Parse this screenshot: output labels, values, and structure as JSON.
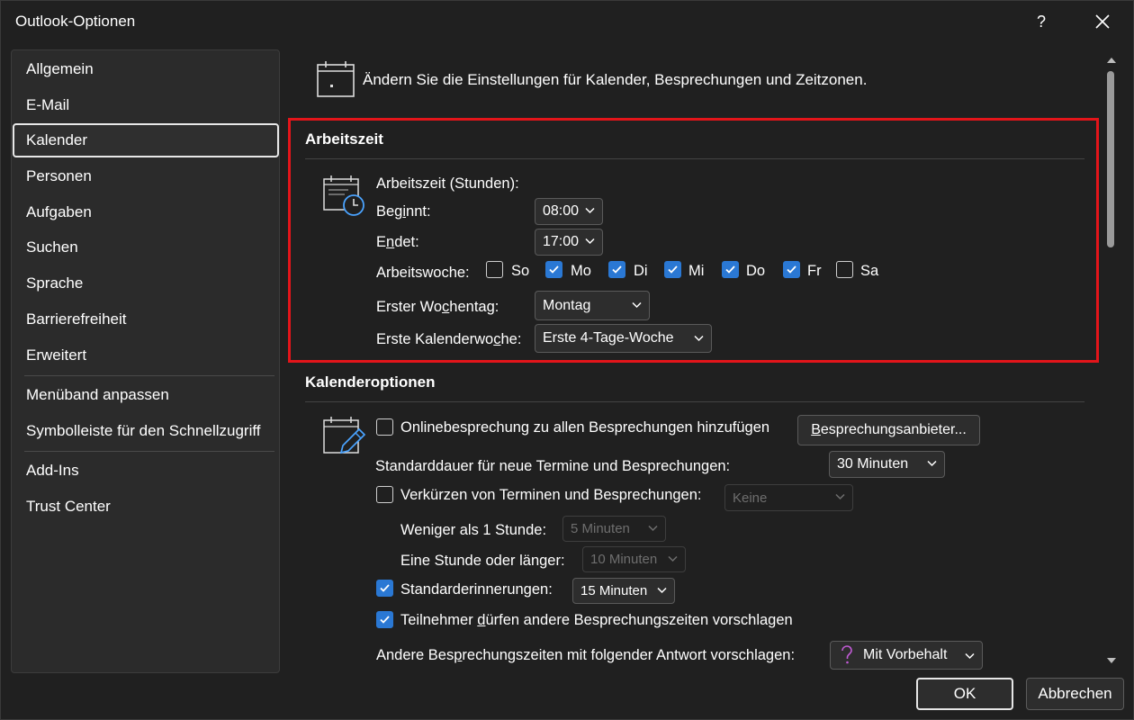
{
  "window": {
    "title": "Outlook-Optionen",
    "help_label": "?"
  },
  "sidebar": {
    "items": [
      {
        "label": "Allgemein"
      },
      {
        "label": "E-Mail"
      },
      {
        "label": "Kalender",
        "selected": true
      },
      {
        "label": "Personen"
      },
      {
        "label": "Aufgaben"
      },
      {
        "label": "Suchen"
      },
      {
        "label": "Sprache"
      },
      {
        "label": "Barrierefreiheit"
      },
      {
        "label": "Erweitert"
      },
      {
        "label": "Menüband anpassen"
      },
      {
        "label": "Symbolleiste für den Schnellzugriff"
      },
      {
        "label": "Add-Ins"
      },
      {
        "label": "Trust Center"
      }
    ]
  },
  "main": {
    "header_text": "Ändern Sie die Einstellungen für Kalender, Besprechungen und Zeitzonen.",
    "work_time": {
      "section_title": "Arbeitszeit",
      "hours_label": "Arbeitszeit (Stunden):",
      "start_label_pre": "Beg",
      "start_label_u": "i",
      "start_label_post": "nnt:",
      "start_value": "08:00",
      "end_label_pre": "E",
      "end_label_u": "n",
      "end_label_post": "det:",
      "end_value": "17:00",
      "week_label": "Arbeitswoche:",
      "days": [
        {
          "label": "So",
          "checked": false
        },
        {
          "label": "Mo",
          "checked": true
        },
        {
          "label": "Di",
          "checked": true
        },
        {
          "label": "Mi",
          "checked": true
        },
        {
          "label": "Do",
          "checked": true
        },
        {
          "label": "Fr",
          "checked": true
        },
        {
          "label": "Sa",
          "checked": false
        }
      ],
      "first_day_label_pre": "Erster Wo",
      "first_day_label_u": "c",
      "first_day_label_post": "hentag:",
      "first_day_value": "Montag",
      "first_week_label_pre": "Erste Kalenderwo",
      "first_week_label_u": "c",
      "first_week_label_post": "he:",
      "first_week_value": "Erste 4-Tage-Woche"
    },
    "calendar_options": {
      "section_title": "Kalenderoptionen",
      "online_meeting_label": "Onlinebesprechung zu allen Besprechungen hinzufügen",
      "online_meeting_checked": false,
      "provider_button_pre": "",
      "provider_button_u": "B",
      "provider_button_post": "esprechungsanbieter...",
      "default_duration_label": "Standarddauer für neue Termine und Besprechungen:",
      "default_duration_value": "30 Minuten",
      "shorten_label": "Verkürzen von Terminen und Besprechungen:",
      "shorten_checked": false,
      "shorten_value": "Keine",
      "less_hour_label": "Weniger als 1 Stunde:",
      "less_hour_value": "5 Minuten",
      "hour_more_label": "Eine Stunde oder länger:",
      "hour_more_value": "10 Minuten",
      "reminders_label": "Standarderinnerungen:",
      "reminders_checked": true,
      "reminders_value": "15 Minuten",
      "propose_label_pre": "Teilnehmer ",
      "propose_label_u": "d",
      "propose_label_post": "ürfen andere Besprechungszeiten vorschlagen",
      "propose_checked": true,
      "response_label_pre": "Andere Bes",
      "response_label_u": "p",
      "response_label_post": "rechungszeiten mit folgender Antwort vorschlagen:",
      "response_value": "Mit Vorbehalt",
      "response_icon": "question-mark-icon"
    }
  },
  "footer": {
    "ok_label": "OK",
    "cancel_label": "Abbrechen"
  },
  "colors": {
    "accent": "#2a78d4",
    "highlight": "#e3151a",
    "background": "#202020",
    "tentative": "#c25bd6"
  }
}
